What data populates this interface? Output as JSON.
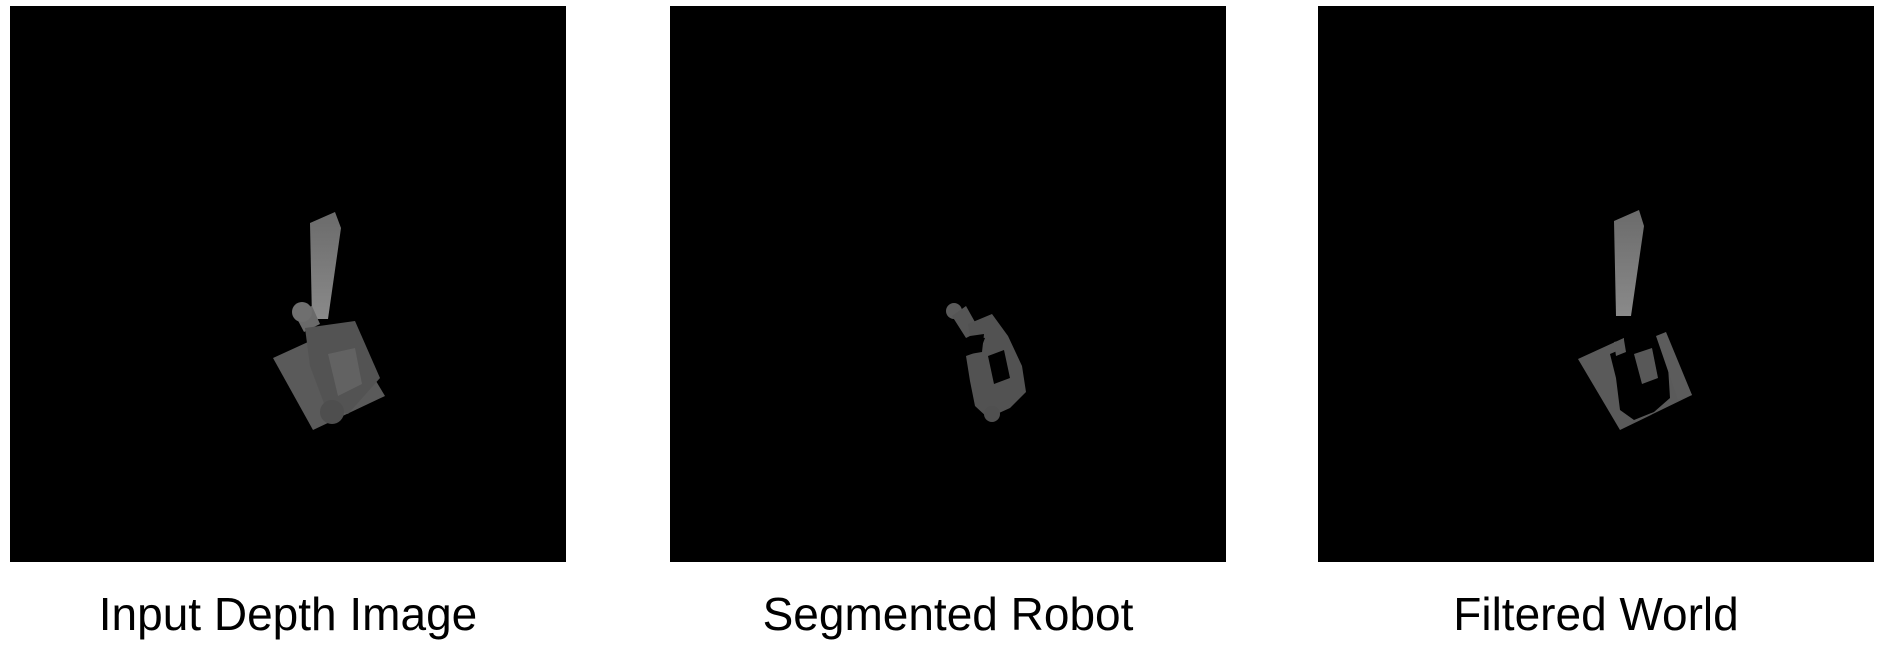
{
  "panels": [
    {
      "id": "input",
      "caption": "Input Depth Image"
    },
    {
      "id": "segmented",
      "caption": "Segmented Robot"
    },
    {
      "id": "filtered",
      "caption": "Filtered World"
    }
  ],
  "colors": {
    "background": "#000000",
    "page": "#ffffff",
    "depth_light": "#7a7a7a",
    "depth_mid": "#5f5f5f",
    "depth_dark": "#4a4a4a"
  }
}
